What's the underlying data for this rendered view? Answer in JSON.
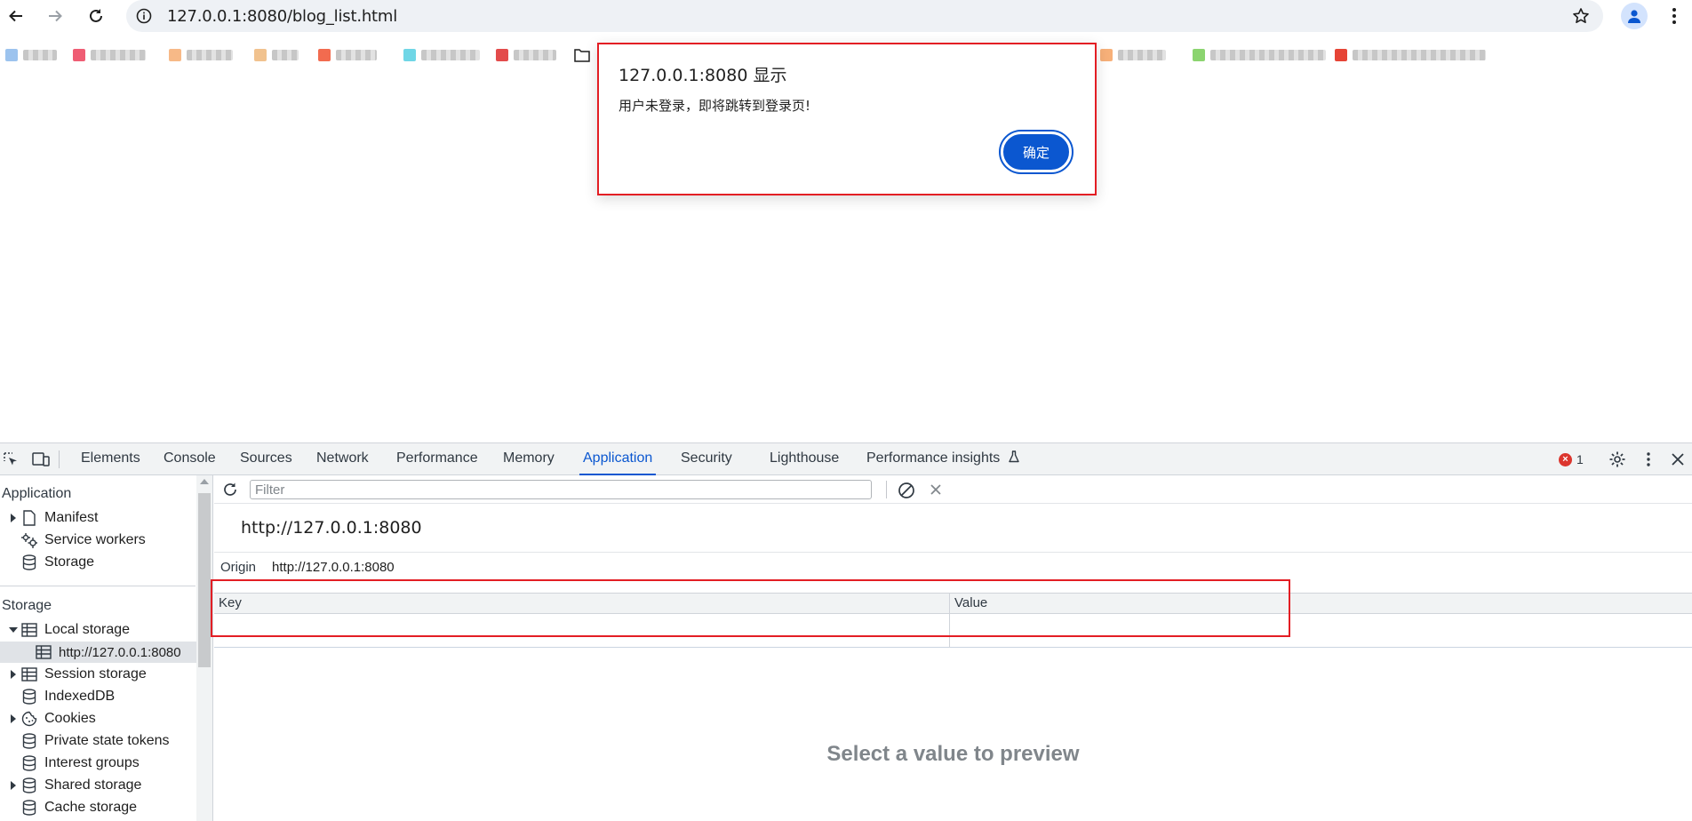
{
  "browser": {
    "url": "127.0.0.1:8080/blog_list.html"
  },
  "dialog": {
    "title": "127.0.0.1:8080 显示",
    "message": "用户未登录，即将跳转到登录页!",
    "ok_label": "确定"
  },
  "devtools": {
    "tabs": [
      {
        "label": "Elements"
      },
      {
        "label": "Console"
      },
      {
        "label": "Sources"
      },
      {
        "label": "Network"
      },
      {
        "label": "Performance"
      },
      {
        "label": "Memory"
      },
      {
        "label": "Application"
      },
      {
        "label": "Security"
      },
      {
        "label": "Lighthouse"
      },
      {
        "label": "Performance insights"
      }
    ],
    "error_count": "1",
    "sidebar": {
      "application_heading": "Application",
      "application_items": [
        {
          "label": "Manifest"
        },
        {
          "label": "Service workers"
        },
        {
          "label": "Storage"
        }
      ],
      "storage_heading": "Storage",
      "storage_items": [
        {
          "label": "Local storage"
        },
        {
          "label": "http://127.0.0.1:8080"
        },
        {
          "label": "Session storage"
        },
        {
          "label": "IndexedDB"
        },
        {
          "label": "Cookies"
        },
        {
          "label": "Private state tokens"
        },
        {
          "label": "Interest groups"
        },
        {
          "label": "Shared storage"
        },
        {
          "label": "Cache storage"
        }
      ]
    },
    "main": {
      "filter_placeholder": "Filter",
      "origin_title": "http://127.0.0.1:8080",
      "origin_label": "Origin",
      "origin_value": "http://127.0.0.1:8080",
      "table_columns": [
        "Key",
        "Value"
      ],
      "preview_text": "Select a value to preview"
    }
  },
  "colors": {
    "accent": "#0b57d0",
    "highlight": "#e31e24"
  }
}
